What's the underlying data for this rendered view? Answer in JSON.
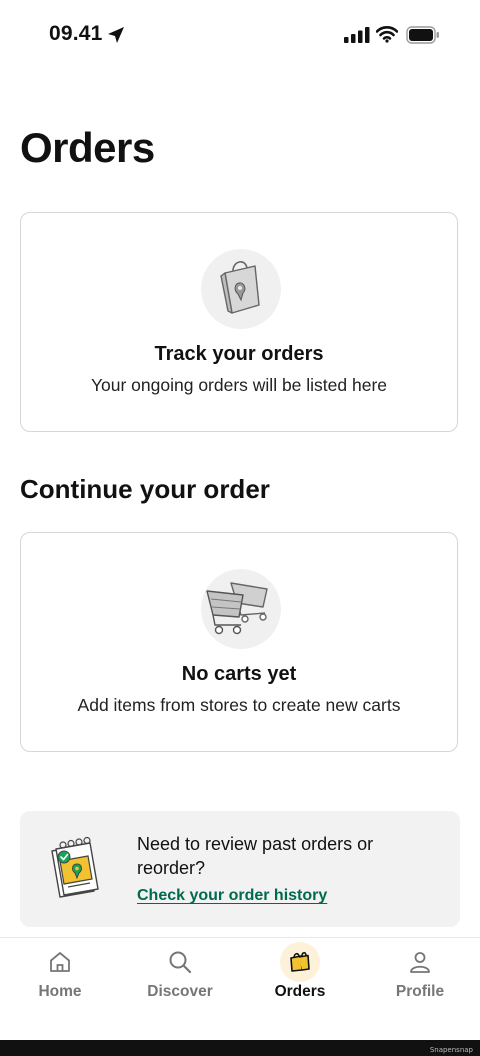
{
  "status_bar": {
    "time": "09.41"
  },
  "page": {
    "title": "Orders"
  },
  "track_card": {
    "title": "Track your orders",
    "subtitle": "Your ongoing orders will be listed here",
    "icon": "shopping-bag-pin-icon"
  },
  "continue_section": {
    "title": "Continue your order"
  },
  "carts_card": {
    "title": "No carts yet",
    "subtitle": "Add items from stores to create new carts",
    "icon": "shopping-carts-icon"
  },
  "history_banner": {
    "text": "Need to review past orders or reorder?",
    "link": "Check your order history",
    "icon": "receipt-notepad-icon"
  },
  "tab_bar": {
    "items": [
      {
        "label": "Home",
        "icon": "home-icon"
      },
      {
        "label": "Discover",
        "icon": "search-icon"
      },
      {
        "label": "Orders",
        "icon": "orders-bag-icon",
        "active": true
      },
      {
        "label": "Profile",
        "icon": "profile-icon"
      }
    ]
  },
  "watermark": "Snapensnap",
  "colors": {
    "link": "#006a4e",
    "active_tab_bg": "#fdf1d9",
    "card_border": "#d6d6d6",
    "banner_bg": "#f2f2f2"
  }
}
